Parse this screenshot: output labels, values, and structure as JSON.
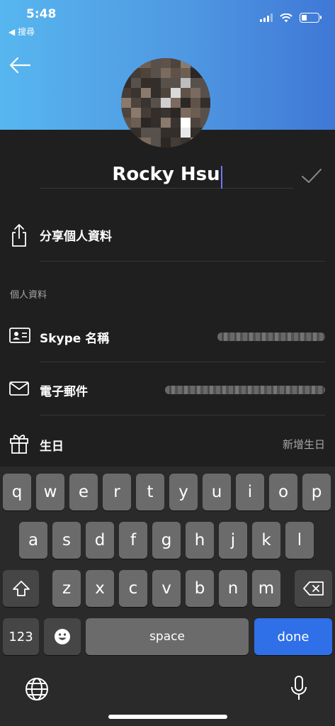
{
  "status_bar": {
    "time": "5:48",
    "back_app": "◀ 搜尋",
    "battery_level": 0.3
  },
  "profile": {
    "name": "Rocky Hsu"
  },
  "share": {
    "label": "分享個人資料"
  },
  "section": {
    "title": "個人資料"
  },
  "fields": [
    {
      "label": "Skype 名稱",
      "value": ""
    },
    {
      "label": "電子郵件",
      "value": ""
    },
    {
      "label": "生日",
      "value": "新增生日"
    }
  ],
  "keyboard": {
    "row1": [
      "q",
      "w",
      "e",
      "r",
      "t",
      "y",
      "u",
      "i",
      "o",
      "p"
    ],
    "row2": [
      "a",
      "s",
      "d",
      "f",
      "g",
      "h",
      "j",
      "k",
      "l"
    ],
    "row3": [
      "z",
      "x",
      "c",
      "v",
      "b",
      "n",
      "m"
    ],
    "numbers_label": "123",
    "space_label": "space",
    "done_label": "done"
  },
  "icons": [
    "back-arrow-icon",
    "check-icon",
    "share-icon",
    "contact-card-icon",
    "mail-icon",
    "gift-icon",
    "shift-icon",
    "delete-icon",
    "emoji-icon",
    "globe-icon",
    "microphone-icon"
  ],
  "colors": {
    "header_start": "#57b6ef",
    "header_end": "#3f78d6",
    "done_key": "#2f6fe8",
    "caret": "#6e74ff",
    "background": "#1f1f1f"
  }
}
